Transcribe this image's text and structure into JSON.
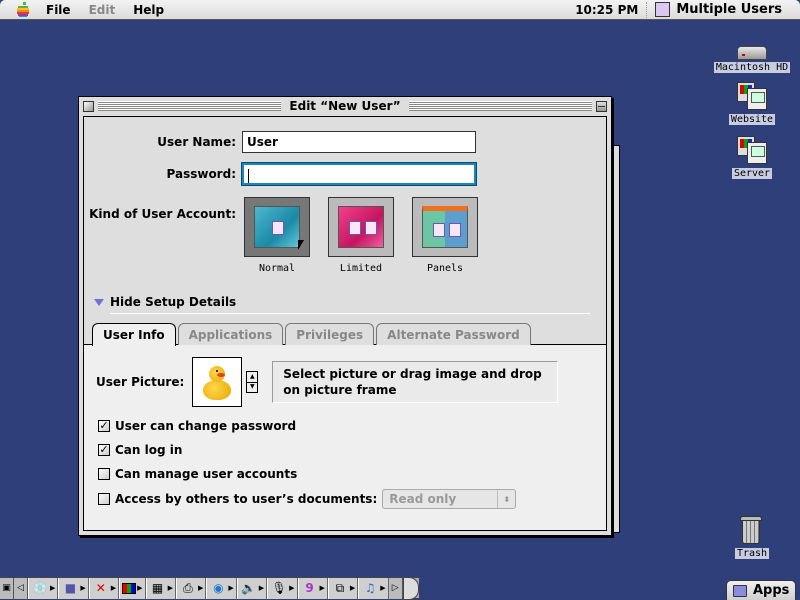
{
  "menubar": {
    "menus": [
      "File",
      "Edit",
      "Help"
    ],
    "disabled": [
      "Edit"
    ],
    "clock": "10:25 PM",
    "app_name": "Multiple Users"
  },
  "desktop": {
    "icons": [
      {
        "label": "Macintosh HD",
        "icon": "hard-disk-icon"
      },
      {
        "label": "Website",
        "icon": "network-computer-icon"
      },
      {
        "label": "Server",
        "icon": "network-computer-icon"
      },
      {
        "label": "Trash",
        "icon": "trash-icon"
      }
    ]
  },
  "window": {
    "title": "Edit “New User”",
    "user_name_label": "User Name:",
    "user_name_value": "User",
    "password_label": "Password:",
    "password_value": "",
    "kind_label": "Kind of User Account:",
    "kinds": [
      {
        "label": "Normal",
        "selected": true
      },
      {
        "label": "Limited",
        "selected": false
      },
      {
        "label": "Panels",
        "selected": false
      }
    ],
    "disclosure_label": "Hide Setup Details",
    "tabs": [
      {
        "label": "User Info",
        "active": true
      },
      {
        "label": "Applications",
        "active": false
      },
      {
        "label": "Privileges",
        "active": false
      },
      {
        "label": "Alternate Password",
        "active": false
      }
    ],
    "user_info": {
      "picture_label": "User Picture:",
      "picture": "rubber-duck",
      "hint": "Select picture or drag image and drop on picture frame",
      "checkboxes": [
        {
          "label": "User can change password",
          "checked": true
        },
        {
          "label": "Can log in",
          "checked": true
        },
        {
          "label": "Can manage user accounts",
          "checked": false
        },
        {
          "label": "Access by others to user’s documents:",
          "checked": false
        }
      ],
      "access_popup_value": "Read only"
    }
  },
  "control_strip": {
    "items": [
      "cd-icon",
      "file-sharing-icon",
      "keychain-icon",
      "monitor-bit-depth-icon",
      "resolution-icon",
      "printer-icon",
      "quicktime-icon",
      "sound-volume-icon",
      "speech-icon",
      "sherlock-icon",
      "location-manager-icon",
      "itunes-icon"
    ]
  },
  "apps_tab": {
    "label": "Apps"
  }
}
